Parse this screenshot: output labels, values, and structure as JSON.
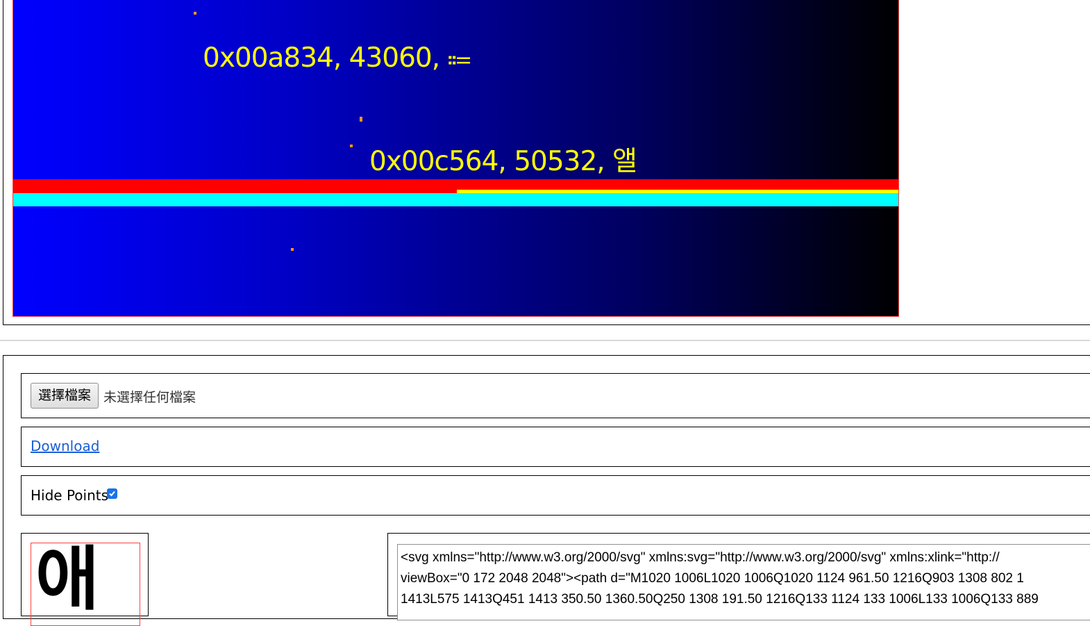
{
  "canvas": {
    "labels": [
      {
        "text": "0x00a834, 43060, ⩴"
      },
      {
        "text": "0x00c564, 50532, 앨"
      }
    ],
    "colors": {
      "label": "#ffff00",
      "point": "#ff9900",
      "band_red": "#ff0000",
      "band_yellow": "#ffff00",
      "band_cyan": "#00ffff",
      "border": "#ff4040"
    }
  },
  "file_input": {
    "button_label": "選擇檔案",
    "status": "未選擇任何檔案"
  },
  "download": {
    "label": "Download"
  },
  "hide_points": {
    "label": "Hide Points",
    "checked": true
  },
  "glyph_preview": {
    "char": "애"
  },
  "svg_output": {
    "text": "<svg xmlns=\"http://www.w3.org/2000/svg\" xmlns:svg=\"http://www.w3.org/2000/svg\" xmlns:xlink=\"http://\nviewBox=\"0 172 2048 2048\"><path d=\"M1020 1006L1020 1006Q1020 1124 961.50 1216Q903 1308 802 1\n1413L575 1413Q451 1413 350.50 1360.50Q250 1308 191.50 1216Q133 1124 133 1006L133 1006Q133 889"
  }
}
